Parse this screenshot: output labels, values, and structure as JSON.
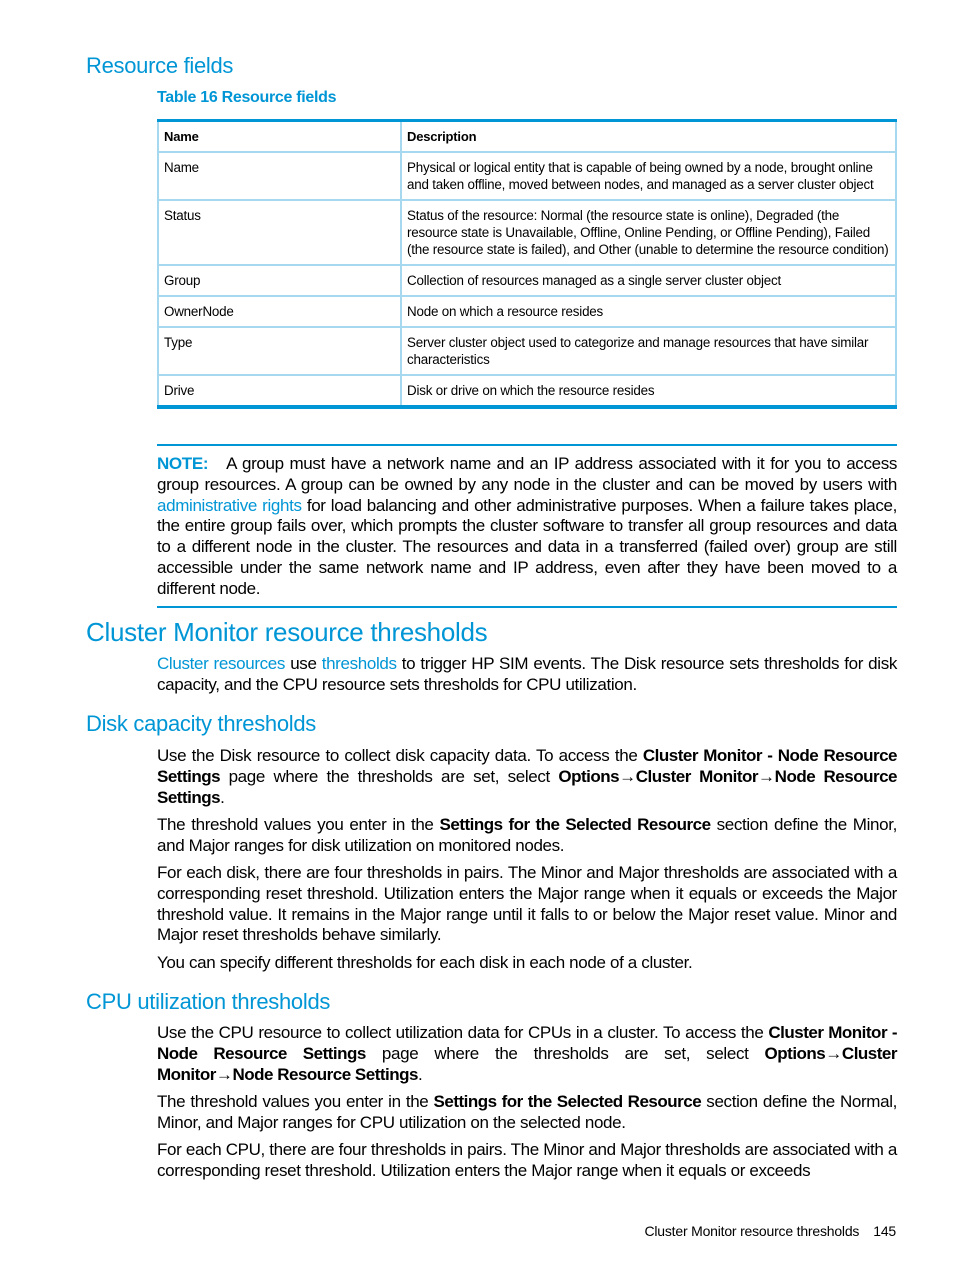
{
  "headings": {
    "resource_fields": "Resource fields",
    "cluster_thresholds": "Cluster Monitor resource thresholds",
    "disk_thresholds": "Disk capacity thresholds",
    "cpu_thresholds": "CPU utilization thresholds"
  },
  "table": {
    "caption": "Table 16 Resource fields",
    "headers": [
      "Name",
      "Description"
    ],
    "rows": [
      {
        "name": "Name",
        "description": "Physical or logical entity that is capable of being owned by a node, brought online and taken offline, moved between nodes, and managed as a server cluster object"
      },
      {
        "name": "Status",
        "description": "Status of the resource: Normal (the resource state is online), Degraded (the resource state is Unavailable, Offline, Online Pending, or Offline Pending), Failed (the resource state is failed), and Other (unable to determine the resource condition)"
      },
      {
        "name": "Group",
        "description": "Collection of resources managed as a single server cluster object"
      },
      {
        "name": "OwnerNode",
        "description": "Node on which a resource resides"
      },
      {
        "name": "Type",
        "description": "Server cluster object used to categorize and manage resources that have similar characteristics"
      },
      {
        "name": "Drive",
        "description": "Disk or drive on which the resource resides"
      }
    ]
  },
  "note": {
    "label": "NOTE:",
    "text_1": "A group must have a network name and an IP address associated with it for you to access group resources. A group can be owned by any node in the cluster and can be moved by users with ",
    "link": "administrative rights",
    "text_2": " for load balancing and other administrative purposes. When a failure takes place, the entire group fails over, which prompts the cluster software to transfer all group resources and data to a different node in the cluster. The resources and data in a transferred (failed over) group are still accessible under the same network name and IP address, even after they have been moved to a different node."
  },
  "cluster_intro": {
    "link_1": "Cluster resources",
    "text_1": " use ",
    "link_2": "thresholds",
    "text_2": " to trigger HP SIM events. The Disk resource sets thresholds for disk capacity, and the CPU resource sets thresholds for CPU utilization."
  },
  "disk": {
    "p1": {
      "t1": "Use the Disk resource to collect disk capacity data. To access the ",
      "b1": "Cluster Monitor - Node Resource Settings",
      "t2": " page where the thresholds are set, select ",
      "b2": "Options",
      "arrow1": "→",
      "b3": "Cluster Monitor",
      "arrow2": "→",
      "b4": "Node Resource Settings",
      "t3": "."
    },
    "p2": {
      "t1": "The threshold values you enter in the ",
      "b1": "Settings for the Selected Resource",
      "t2": " section define the Minor, and Major ranges for disk utilization on monitored nodes."
    },
    "p3": "For each disk, there are four thresholds in pairs. The Minor and Major thresholds are associated with a corresponding reset threshold. Utilization enters the Major range when it equals or exceeds the Major threshold value. It remains in the Major range until it falls to or below the Major reset value. Minor and Major reset thresholds behave similarly.",
    "p4": "You can specify different thresholds for each disk in each node of a cluster."
  },
  "cpu": {
    "p1": {
      "t1": "Use the CPU resource to collect utilization data for CPUs in a cluster. To access the ",
      "b1": "Cluster Monitor - Node Resource Settings",
      "t2": " page where the thresholds are set, select ",
      "b2": "Options",
      "arrow1": "→",
      "b3": "Cluster Monitor",
      "arrow2": "→",
      "b4": "Node Resource Settings",
      "t3": "."
    },
    "p2": {
      "t1": "The threshold values you enter in the ",
      "b1": "Settings for the Selected Resource",
      "t2": " section define the Normal, Minor, and Major ranges for CPU utilization on the selected node."
    },
    "p3": "For each CPU, there are four thresholds in pairs. The Minor and Major thresholds are associated with a corresponding reset threshold. Utilization enters the Major range when it equals or exceeds"
  },
  "footer": {
    "section": "Cluster Monitor resource thresholds",
    "page_number": "145"
  }
}
